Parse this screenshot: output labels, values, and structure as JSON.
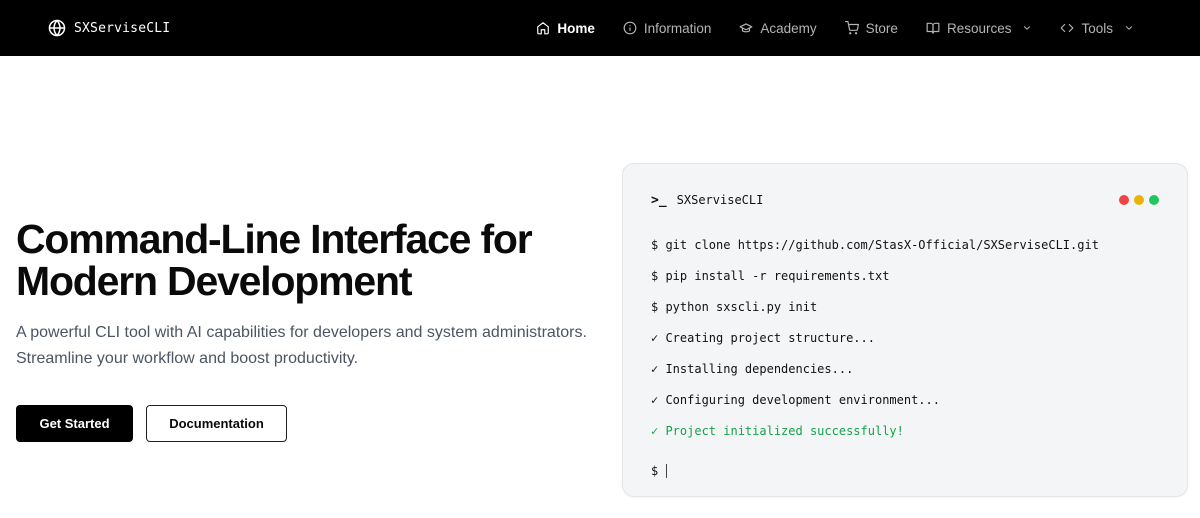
{
  "nav": {
    "brand": "SXServiseCLI",
    "items": [
      {
        "label": "Home",
        "icon": "home-icon",
        "active": true
      },
      {
        "label": "Information",
        "icon": "info-icon"
      },
      {
        "label": "Academy",
        "icon": "graduation-cap-icon"
      },
      {
        "label": "Store",
        "icon": "cart-icon"
      },
      {
        "label": "Resources",
        "icon": "book-icon",
        "dropdown": true
      },
      {
        "label": "Tools",
        "icon": "code-icon",
        "dropdown": true
      }
    ]
  },
  "hero": {
    "title_line1": "Command-Line Interface for",
    "title_line2": "Modern Development",
    "subtitle_line1": "A powerful CLI tool with AI capabilities for developers and system administrators.",
    "subtitle_line2": "Streamline your workflow and boost productivity.",
    "primary_button": "Get Started",
    "secondary_button": "Documentation"
  },
  "terminal": {
    "prompt_icon": ">_",
    "title": "SXServiseCLI",
    "lines": [
      "$ git clone https://github.com/StasX-Official/SXServiseCLI.git",
      "$ pip install -r requirements.txt",
      "$ python sxscli.py init",
      "✓ Creating project structure...",
      "✓ Installing dependencies...",
      "✓ Configuring development environment...",
      "✓ Project initialized successfully!"
    ],
    "prompt": "$",
    "colors": {
      "success": "#16a34a",
      "dot_red": "#ef4444",
      "dot_yellow": "#eab308",
      "dot_green": "#22c55e"
    }
  }
}
